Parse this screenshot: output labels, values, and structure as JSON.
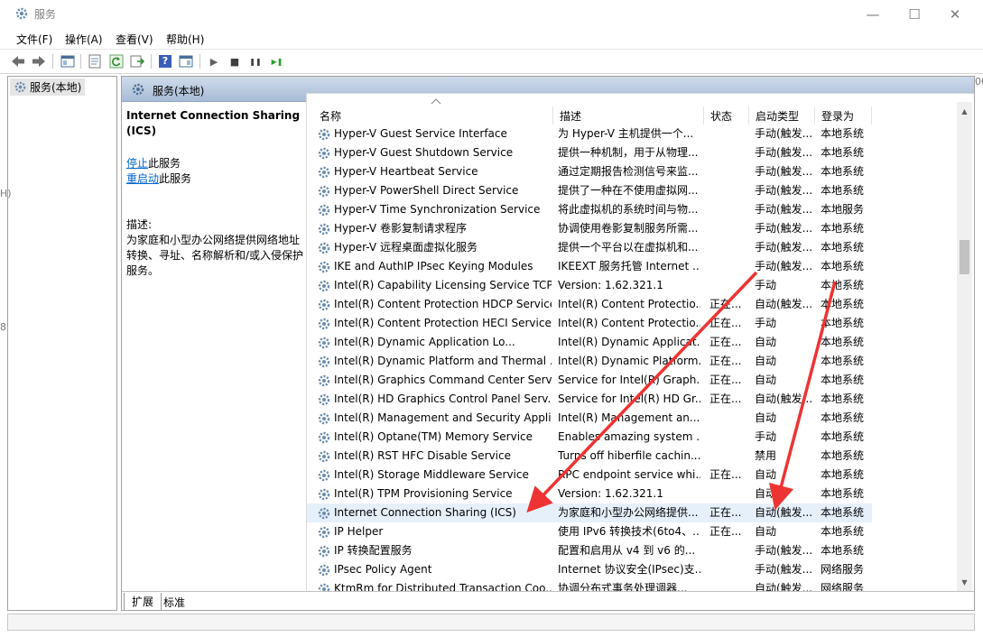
{
  "window": {
    "title": "服务",
    "minimize_glyph": "—",
    "maximize_glyph": "☐",
    "close_glyph": "✕"
  },
  "menu": [
    "文件(F)",
    "操作(A)",
    "查看(V)",
    "帮助(H)"
  ],
  "toolbar": {
    "icons": [
      "back-icon",
      "forward-icon",
      "show-hide-tree-icon",
      "properties-icon",
      "refresh-icon",
      "export-list-icon",
      "help-icon",
      "show-action-pane-icon",
      "start-service-icon",
      "stop-service-icon",
      "pause-service-icon",
      "restart-service-icon"
    ],
    "start_glyph": "▶",
    "stop_glyph": "■",
    "pause_glyph": "❚❚",
    "restart_glyph": "▶❚",
    "help_glyph": "?"
  },
  "tree": {
    "item": "服务(本地)"
  },
  "pane": {
    "header": "服务(本地)",
    "service_title": "Internet Connection Sharing (ICS)",
    "stop_link": "停止",
    "stop_suffix": "此服务",
    "restart_link": "重启动",
    "restart_suffix": "此服务",
    "desc_label": "描述:",
    "desc_text": "为家庭和小型办公网络提供网络地址转换、寻址、名称解析和/或入侵保护服务。"
  },
  "columns": {
    "name": "名称",
    "desc": "描述",
    "status": "状态",
    "start": "启动类型",
    "logon": "登录为"
  },
  "services": [
    {
      "name": "Hyper-V Guest Service Interface",
      "desc": "为 Hyper-V 主机提供一个...",
      "status": "",
      "start": "手动(触发...",
      "logon": "本地系统"
    },
    {
      "name": "Hyper-V Guest Shutdown Service",
      "desc": "提供一种机制，用于从物理...",
      "status": "",
      "start": "手动(触发...",
      "logon": "本地系统"
    },
    {
      "name": "Hyper-V Heartbeat Service",
      "desc": "通过定期报告检测信号来监...",
      "status": "",
      "start": "手动(触发...",
      "logon": "本地系统"
    },
    {
      "name": "Hyper-V PowerShell Direct Service",
      "desc": "提供了一种在不使用虚拟网...",
      "status": "",
      "start": "手动(触发...",
      "logon": "本地系统"
    },
    {
      "name": "Hyper-V Time Synchronization Service",
      "desc": "将此虚拟机的系统时间与物...",
      "status": "",
      "start": "手动(触发...",
      "logon": "本地服务"
    },
    {
      "name": "Hyper-V 卷影复制请求程序",
      "desc": "协调使用卷影复制服务所需...",
      "status": "",
      "start": "手动(触发...",
      "logon": "本地系统"
    },
    {
      "name": "Hyper-V 远程桌面虚拟化服务",
      "desc": "提供一个平台以在虚拟机和...",
      "status": "",
      "start": "手动(触发...",
      "logon": "本地系统"
    },
    {
      "name": "IKE and AuthIP IPsec Keying Modules",
      "desc": "IKEEXT 服务托管 Internet ...",
      "status": "",
      "start": "手动(触发...",
      "logon": "本地系统"
    },
    {
      "name": "Intel(R) Capability Licensing Service TCP...",
      "desc": "Version: 1.62.321.1",
      "status": "",
      "start": "手动",
      "logon": "本地系统"
    },
    {
      "name": "Intel(R) Content Protection HDCP Service",
      "desc": "Intel(R) Content Protectio...",
      "status": "正在...",
      "start": "自动(触发...",
      "logon": "本地系统"
    },
    {
      "name": "Intel(R) Content Protection HECI Service",
      "desc": "Intel(R) Content Protectio...",
      "status": "正在...",
      "start": "手动",
      "logon": "本地系统"
    },
    {
      "name": "Intel(R) Dynamic Application Lo...",
      "desc": "Intel(R) Dynamic Applicat...",
      "status": "正在...",
      "start": "自动",
      "logon": "本地系统"
    },
    {
      "name": "Intel(R) Dynamic Platform and Thermal ...",
      "desc": "Intel(R) Dynamic Platform...",
      "status": "正在...",
      "start": "自动",
      "logon": "本地系统"
    },
    {
      "name": "Intel(R) Graphics Command Center Serv...",
      "desc": "Service for Intel(R) Graph...",
      "status": "正在...",
      "start": "自动",
      "logon": "本地系统"
    },
    {
      "name": "Intel(R) HD Graphics Control Panel Serv...",
      "desc": "Service for Intel(R) HD Gr...",
      "status": "正在...",
      "start": "自动(触发...",
      "logon": "本地系统"
    },
    {
      "name": "Intel(R) Management and Security Appli...",
      "desc": "Intel(R) Management an...",
      "status": "",
      "start": "自动",
      "logon": "本地系统"
    },
    {
      "name": "Intel(R) Optane(TM) Memory Service",
      "desc": "Enables amazing system ...",
      "status": "",
      "start": "手动",
      "logon": "本地系统"
    },
    {
      "name": "Intel(R) RST HFC Disable Service",
      "desc": "Turns off hiberfile cachin...",
      "status": "",
      "start": "禁用",
      "logon": "本地系统"
    },
    {
      "name": "Intel(R) Storage Middleware Service",
      "desc": "RPC endpoint service whi...",
      "status": "正在...",
      "start": "自动",
      "logon": "本地系统"
    },
    {
      "name": "Intel(R) TPM Provisioning Service",
      "desc": "Version: 1.62.321.1",
      "status": "",
      "start": "自动",
      "logon": "本地系统"
    },
    {
      "name": "Internet Connection Sharing (ICS)",
      "desc": "为家庭和小型办公网络提供...",
      "status": "正在...",
      "start": "自动(触发...",
      "logon": "本地系统",
      "selected": true
    },
    {
      "name": "IP Helper",
      "desc": "使用 IPv6 转换技术(6to4、...",
      "status": "正在...",
      "start": "自动",
      "logon": "本地系统"
    },
    {
      "name": "IP 转换配置服务",
      "desc": "配置和启用从 v4 到 v6 的...",
      "status": "",
      "start": "手动(触发...",
      "logon": "本地系统"
    },
    {
      "name": "IPsec Policy Agent",
      "desc": "Internet 协议安全(IPsec)支...",
      "status": "",
      "start": "手动(触发...",
      "logon": "网络服务"
    },
    {
      "name": "KtmRm for Distributed Transaction Coo...",
      "desc": "协调分布式事务处理调器...",
      "status": "",
      "start": "自动(触发...",
      "logon": "网络服务"
    }
  ],
  "tabs": [
    "扩展",
    "标准"
  ],
  "edge_glyphs": [
    "00",
    "H)",
    "8"
  ],
  "colors": {
    "header_gradient_top": "#cfdcec",
    "header_gradient_bottom": "#a8bcd6",
    "link": "#0066cc",
    "annotation_arrow": "#ee3333",
    "selected_row": "#e5f0fb"
  }
}
